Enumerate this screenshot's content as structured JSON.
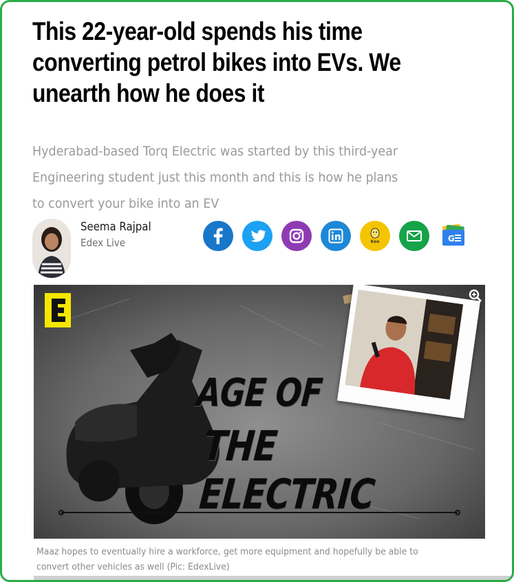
{
  "article": {
    "headline": "This 22-year-old spends his time converting petrol bikes into EVs. We unearth how he does it",
    "subhead": "Hyderabad-based Torq Electric was started by this third-year Engineering student just this month and this is how he plans to convert your bike into an EV"
  },
  "author": {
    "name": "Seema Rajpal",
    "outlet": "Edex Live"
  },
  "share": [
    {
      "name": "facebook",
      "icon": "facebook-icon",
      "color": "#1877c9"
    },
    {
      "name": "twitter",
      "icon": "twitter-icon",
      "color": "#1da1f2"
    },
    {
      "name": "instagram",
      "icon": "instagram-icon",
      "color": "#8e3bb3"
    },
    {
      "name": "linkedin",
      "icon": "linkedin-icon",
      "color": "#1e88d6"
    },
    {
      "name": "koo",
      "icon": "koo-icon",
      "color": "#f5c400",
      "label": "Koo"
    },
    {
      "name": "email",
      "icon": "mail-icon",
      "color": "#17a34a"
    },
    {
      "name": "google-news",
      "icon": "google-news-icon",
      "color": "#1a73e8"
    }
  ],
  "hero": {
    "overlay_line1": "AGE OF",
    "overlay_line2": "THE ELECTRIC",
    "brand_letter": "E"
  },
  "caption": "Maaz hopes to eventually hire a workforce, get more equipment and hopefully be able to convert other vehicles as well (Pic: EdexLive)",
  "colors": {
    "border": "#2bac4a",
    "brand_yellow": "#f7e600"
  }
}
